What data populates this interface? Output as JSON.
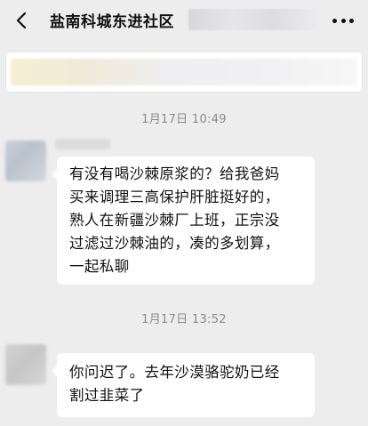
{
  "header": {
    "title": "盐南科城东进社区",
    "back_icon": "chevron-left-icon",
    "more_icon": "more-dots-icon"
  },
  "messages": [
    {
      "timestamp": "1月17日 10:49",
      "lines": [
        "有没有喝沙棘原浆的？给我爸妈",
        "买来调理三高保护肝脏挺好的，",
        "熟人在新疆沙棘厂上班，正宗没",
        "过滤过沙棘油的，凑的多划算，",
        "一起私聊"
      ]
    },
    {
      "timestamp": "1月17日 13:52",
      "lines": [
        "你问迟了。去年沙漠骆驼奶已经",
        "割过韭菜了"
      ]
    }
  ]
}
